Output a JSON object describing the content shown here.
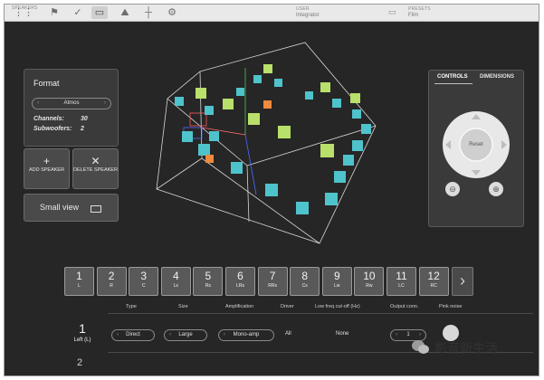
{
  "topbar": {
    "icons": [
      {
        "name": "keypad-icon",
        "glyph": "⋮⋮",
        "active": false
      },
      {
        "name": "flag-icon",
        "glyph": "⚑",
        "active": false
      },
      {
        "name": "check-icon",
        "glyph": "✓",
        "active": false
      },
      {
        "name": "monitor-icon",
        "glyph": "▭",
        "active": true
      },
      {
        "name": "mountain-icon",
        "glyph": "⛰",
        "active": false
      },
      {
        "name": "crosshair-icon",
        "glyph": "┼",
        "active": false
      },
      {
        "name": "settings-icon",
        "glyph": "⚙",
        "active": false
      }
    ],
    "small_caption": "SPEAKERS",
    "user_label": "USER",
    "user_value": "Integrator",
    "presets_label": "PRESETS",
    "presets_value": "Film"
  },
  "format": {
    "title": "Format",
    "selected": "Atmos",
    "channels_label": "Channels:",
    "channels_value": "30",
    "subwoofers_label": "Subwoofers:",
    "subwoofers_value": "2"
  },
  "buttons": {
    "add_icon": "+",
    "add_label": "ADD SPEAKER",
    "delete_icon": "✕",
    "delete_label": "DELETE SPEAKER",
    "small_view": "Small view"
  },
  "controls": {
    "tab_controls": "CONTROLS",
    "tab_dimensions": "DIMENSIONS",
    "reset": "Reset"
  },
  "speakers": [
    {
      "num": "1",
      "code": "L"
    },
    {
      "num": "2",
      "code": "R"
    },
    {
      "num": "3",
      "code": "C"
    },
    {
      "num": "4",
      "code": "Ls"
    },
    {
      "num": "5",
      "code": "Rs"
    },
    {
      "num": "6",
      "code": "LRs"
    },
    {
      "num": "7",
      "code": "RRs"
    },
    {
      "num": "8",
      "code": "Cs"
    },
    {
      "num": "9",
      "code": "Lw"
    },
    {
      "num": "10",
      "code": "Rw"
    },
    {
      "num": "11",
      "code": "LC"
    },
    {
      "num": "12",
      "code": "RC"
    }
  ],
  "columns": [
    "Type",
    "Size",
    "Amplification",
    "Driver",
    "Low freq cut-off (Hz)",
    "Output conn.",
    "Pink noise"
  ],
  "row": {
    "num": "1",
    "name": "Left (L)",
    "type": "Direct",
    "size": "Large",
    "amplification": "Mono-amp",
    "driver": "All",
    "cutoff": "None",
    "output": "1",
    "next_num": "2"
  },
  "watermark": "影音新生活",
  "colors": {
    "background": "#262626",
    "cube_green": "#b8e06a",
    "cube_cyan": "#4fc3cc",
    "cube_orange": "#f08a3c"
  }
}
